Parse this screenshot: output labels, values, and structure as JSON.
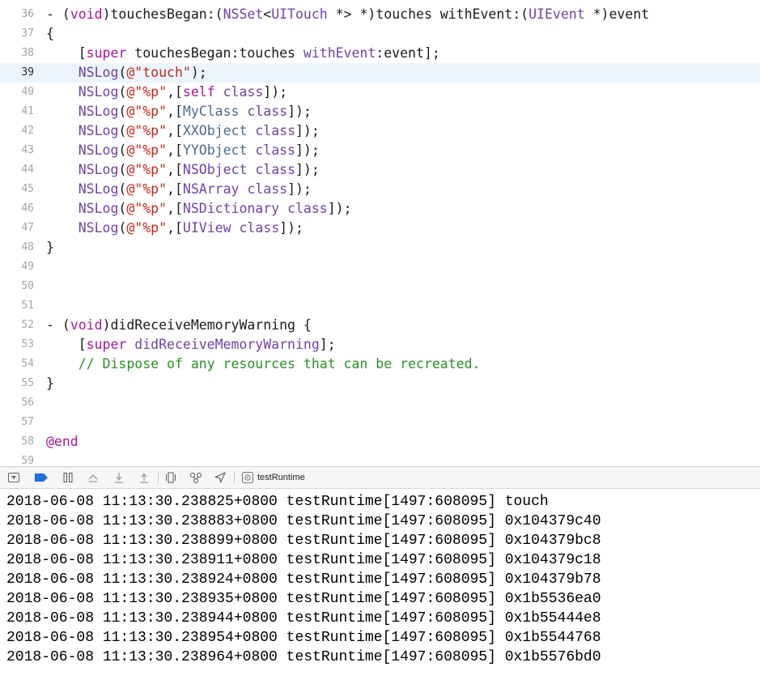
{
  "editor": {
    "current_line": "39",
    "lines": [
      {
        "n": "36",
        "tokens": [
          {
            "t": "- ("
          },
          {
            "t": "void",
            "c": "kw"
          },
          {
            "t": ")touchesBegan:("
          },
          {
            "t": "NSSet",
            "c": "ty"
          },
          {
            "t": "<"
          },
          {
            "t": "UITouch",
            "c": "ty"
          },
          {
            "t": " *> *)touches withEvent:("
          },
          {
            "t": "UIEvent",
            "c": "ty"
          },
          {
            "t": " *)event"
          }
        ]
      },
      {
        "n": "37",
        "tokens": [
          {
            "t": "{"
          }
        ]
      },
      {
        "n": "38",
        "tokens": [
          {
            "t": "    ["
          },
          {
            "t": "super",
            "c": "kw"
          },
          {
            "t": " touchesBegan:touches "
          },
          {
            "t": "withEvent",
            "c": "ty"
          },
          {
            "t": ":event];"
          }
        ]
      },
      {
        "n": "39",
        "tokens": [
          {
            "t": "    "
          },
          {
            "t": "NSLog",
            "c": "ty"
          },
          {
            "t": "("
          },
          {
            "t": "@\"touch\"",
            "c": "str"
          },
          {
            "t": ");"
          }
        ]
      },
      {
        "n": "40",
        "tokens": [
          {
            "t": "    "
          },
          {
            "t": "NSLog",
            "c": "ty"
          },
          {
            "t": "("
          },
          {
            "t": "@\"%p\"",
            "c": "str"
          },
          {
            "t": ",["
          },
          {
            "t": "self",
            "c": "kw"
          },
          {
            "t": " "
          },
          {
            "t": "class",
            "c": "ty"
          },
          {
            "t": "]);"
          }
        ]
      },
      {
        "n": "41",
        "tokens": [
          {
            "t": "    "
          },
          {
            "t": "NSLog",
            "c": "ty"
          },
          {
            "t": "("
          },
          {
            "t": "@\"%p\"",
            "c": "str"
          },
          {
            "t": ",["
          },
          {
            "t": "MyClass",
            "c": "cls"
          },
          {
            "t": " "
          },
          {
            "t": "class",
            "c": "ty"
          },
          {
            "t": "]);"
          }
        ]
      },
      {
        "n": "42",
        "tokens": [
          {
            "t": "    "
          },
          {
            "t": "NSLog",
            "c": "ty"
          },
          {
            "t": "("
          },
          {
            "t": "@\"%p\"",
            "c": "str"
          },
          {
            "t": ",["
          },
          {
            "t": "XXObject",
            "c": "cls"
          },
          {
            "t": " "
          },
          {
            "t": "class",
            "c": "ty"
          },
          {
            "t": "]);"
          }
        ]
      },
      {
        "n": "43",
        "tokens": [
          {
            "t": "    "
          },
          {
            "t": "NSLog",
            "c": "ty"
          },
          {
            "t": "("
          },
          {
            "t": "@\"%p\"",
            "c": "str"
          },
          {
            "t": ",["
          },
          {
            "t": "YYObject",
            "c": "cls"
          },
          {
            "t": " "
          },
          {
            "t": "class",
            "c": "ty"
          },
          {
            "t": "]);"
          }
        ]
      },
      {
        "n": "44",
        "tokens": [
          {
            "t": "    "
          },
          {
            "t": "NSLog",
            "c": "ty"
          },
          {
            "t": "("
          },
          {
            "t": "@\"%p\"",
            "c": "str"
          },
          {
            "t": ",["
          },
          {
            "t": "NSObject",
            "c": "ty"
          },
          {
            "t": " "
          },
          {
            "t": "class",
            "c": "ty"
          },
          {
            "t": "]);"
          }
        ]
      },
      {
        "n": "45",
        "tokens": [
          {
            "t": "    "
          },
          {
            "t": "NSLog",
            "c": "ty"
          },
          {
            "t": "("
          },
          {
            "t": "@\"%p\"",
            "c": "str"
          },
          {
            "t": ",["
          },
          {
            "t": "NSArray",
            "c": "ty"
          },
          {
            "t": " "
          },
          {
            "t": "class",
            "c": "ty"
          },
          {
            "t": "]);"
          }
        ]
      },
      {
        "n": "46",
        "tokens": [
          {
            "t": "    "
          },
          {
            "t": "NSLog",
            "c": "ty"
          },
          {
            "t": "("
          },
          {
            "t": "@\"%p\"",
            "c": "str"
          },
          {
            "t": ",["
          },
          {
            "t": "NSDictionary",
            "c": "ty"
          },
          {
            "t": " "
          },
          {
            "t": "class",
            "c": "ty"
          },
          {
            "t": "]);"
          }
        ]
      },
      {
        "n": "47",
        "tokens": [
          {
            "t": "    "
          },
          {
            "t": "NSLog",
            "c": "ty"
          },
          {
            "t": "("
          },
          {
            "t": "@\"%p\"",
            "c": "str"
          },
          {
            "t": ",["
          },
          {
            "t": "UIView",
            "c": "ty"
          },
          {
            "t": " "
          },
          {
            "t": "class",
            "c": "ty"
          },
          {
            "t": "]);"
          }
        ]
      },
      {
        "n": "48",
        "tokens": [
          {
            "t": "}"
          }
        ]
      },
      {
        "n": "49",
        "tokens": []
      },
      {
        "n": "50",
        "tokens": []
      },
      {
        "n": "51",
        "tokens": []
      },
      {
        "n": "52",
        "tokens": [
          {
            "t": "- ("
          },
          {
            "t": "void",
            "c": "kw"
          },
          {
            "t": ")didReceiveMemoryWarning {"
          }
        ]
      },
      {
        "n": "53",
        "tokens": [
          {
            "t": "    ["
          },
          {
            "t": "super",
            "c": "kw"
          },
          {
            "t": " "
          },
          {
            "t": "didReceiveMemoryWarning",
            "c": "ty"
          },
          {
            "t": "];"
          }
        ]
      },
      {
        "n": "54",
        "tokens": [
          {
            "t": "    "
          },
          {
            "t": "// Dispose of any resources that can be recreated.",
            "c": "cm"
          }
        ]
      },
      {
        "n": "55",
        "tokens": [
          {
            "t": "}"
          }
        ]
      },
      {
        "n": "56",
        "tokens": []
      },
      {
        "n": "57",
        "tokens": []
      },
      {
        "n": "58",
        "tokens": [
          {
            "t": "@end",
            "c": "kw"
          }
        ]
      },
      {
        "n": "59",
        "tokens": []
      }
    ]
  },
  "debug_bar": {
    "target_label": "testRuntime",
    "buttons": [
      {
        "name": "hide-debug-area-button",
        "icon": "collapse-icon"
      },
      {
        "name": "toggle-breakpoints-button",
        "icon": "breakpoint-icon"
      },
      {
        "name": "pause-button",
        "icon": "pause-icon"
      },
      {
        "name": "step-over-button",
        "icon": "step-over-icon"
      },
      {
        "name": "step-into-button",
        "icon": "step-into-icon"
      },
      {
        "name": "step-out-button",
        "icon": "step-out-icon"
      },
      {
        "name": "view-hierarchy-button",
        "icon": "view-hierarchy-icon"
      },
      {
        "name": "memory-graph-button",
        "icon": "memory-graph-icon"
      },
      {
        "name": "simulate-location-button",
        "icon": "location-arrow-icon"
      },
      {
        "name": "target-selector",
        "icon": "gear-icon"
      }
    ],
    "colors": {
      "accent": "#1e6fe0"
    }
  },
  "console": {
    "lines": [
      "2018-06-08 11:13:30.238825+0800 testRuntime[1497:608095] touch",
      "2018-06-08 11:13:30.238883+0800 testRuntime[1497:608095] 0x104379c40",
      "2018-06-08 11:13:30.238899+0800 testRuntime[1497:608095] 0x104379bc8",
      "2018-06-08 11:13:30.238911+0800 testRuntime[1497:608095] 0x104379c18",
      "2018-06-08 11:13:30.238924+0800 testRuntime[1497:608095] 0x104379b78",
      "2018-06-08 11:13:30.238935+0800 testRuntime[1497:608095] 0x1b5536ea0",
      "2018-06-08 11:13:30.238944+0800 testRuntime[1497:608095] 0x1b55444e8",
      "2018-06-08 11:13:30.238954+0800 testRuntime[1497:608095] 0x1b5544768",
      "2018-06-08 11:13:30.238964+0800 testRuntime[1497:608095] 0x1b5576bd0"
    ]
  }
}
